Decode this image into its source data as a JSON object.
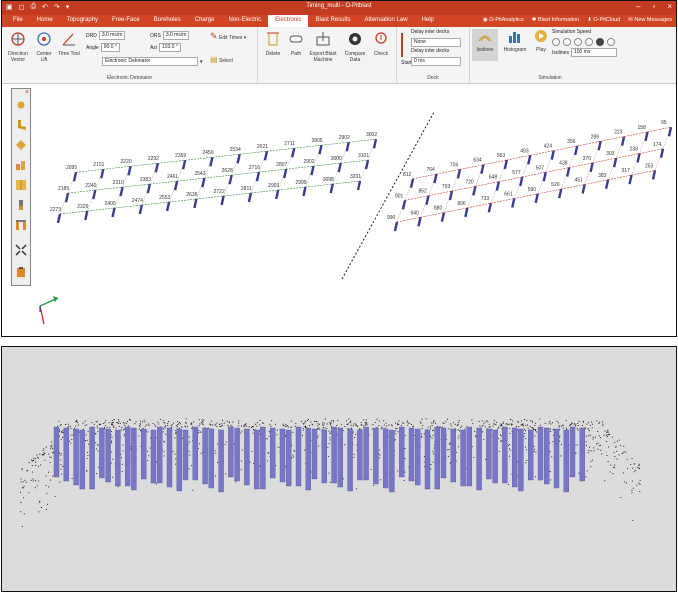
{
  "window": {
    "title": "Timing_multi - O-Pitblast"
  },
  "menu": {
    "tabs": [
      {
        "label": "File"
      },
      {
        "label": "Home"
      },
      {
        "label": "Topography"
      },
      {
        "label": "Free-Face"
      },
      {
        "label": "Boreholes"
      },
      {
        "label": "Charge"
      },
      {
        "label": "Non-Electric"
      },
      {
        "label": "Electronic"
      },
      {
        "label": "Blast Results"
      },
      {
        "label": "Attenuation Law"
      },
      {
        "label": "Help"
      }
    ],
    "right_links": [
      {
        "label": "O-PitAnalytics"
      },
      {
        "label": "Blast Information"
      },
      {
        "label": "O-PitCloud"
      },
      {
        "label": "New Messages"
      }
    ]
  },
  "ribbon": {
    "direction_vector": "Direction Vector",
    "center_lift": "Center Lift",
    "time_tool": "Time Tool",
    "drd_label": "DRD",
    "drd_value": "3.0 ms/m",
    "ors_label": "ORS",
    "ors_value": "3.0 ms/m",
    "angle_label": "Angle",
    "angle_value": "90.0 °",
    "azi_label": "Azi",
    "azi_value": "103.0 °",
    "detonator_value": "Electronic Detonator",
    "edit_times": "Edit Times",
    "select": "Select",
    "group_electronic": "Electronic Detonator",
    "delete": "Delete",
    "path": "Path",
    "export_sheet": "Export Blast Machine",
    "compare_data": "Compare Data",
    "check": "Check",
    "deck_start": "Start",
    "delay_inter_decks": "Delay inter decks",
    "none_value": "None",
    "delay_inter_decks2": "Delay inter decks",
    "zero_value": "0 ms",
    "group_deck": "Deck",
    "isolines": "Isolines",
    "histogram": "Histogram",
    "play": "Play",
    "simulation_speed": "Simulation Speed",
    "isolines_label": "Isolines",
    "isolines_value": "100 ms",
    "group_simulation": "Simulation"
  },
  "left_numbers": [
    "2273",
    "2329",
    "2400",
    "2474",
    "2553",
    "2636",
    "2722",
    "2811",
    "2903",
    "2999",
    "3098",
    "3201",
    "2185",
    "2240",
    "2310",
    "2383",
    "2461",
    "2543",
    "2628",
    "2716",
    "2807",
    "2902",
    "3000",
    "3101",
    "2095",
    "2151",
    "2220",
    "2292",
    "2369",
    "2450",
    "2534",
    "2621",
    "2711",
    "2805",
    "2902",
    "3002"
  ],
  "right_numbers": [
    "990",
    "940",
    "880",
    "806",
    "733",
    "661",
    "590",
    "520",
    "451",
    "383",
    "317",
    "253",
    "901",
    "852",
    "793",
    "720",
    "648",
    "577",
    "507",
    "438",
    "370",
    "303",
    "238",
    "174",
    "812",
    "764",
    "706",
    "634",
    "563",
    "493",
    "424",
    "356",
    "289",
    "223",
    "158",
    "95"
  ],
  "colors": {
    "accent": "#d14424",
    "hole": "#3c3c8e",
    "hole3d": "#7777c6",
    "left_grid": "#3a8a3a",
    "right_grid": "#d23a2a"
  },
  "icons": {
    "palette": [
      "sun-icon",
      "boot-icon",
      "diamond-icon",
      "bars-icon",
      "grid-icon",
      "pillar-icon",
      "gate-icon",
      "expand-icon",
      "battery-icon"
    ]
  }
}
